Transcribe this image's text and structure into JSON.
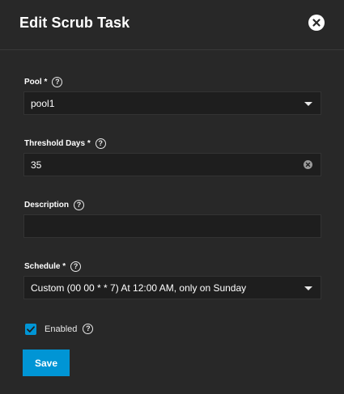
{
  "dialog": {
    "title": "Edit Scrub Task"
  },
  "form": {
    "pool": {
      "label": "Pool",
      "required_mark": "*",
      "value": "pool1"
    },
    "threshold_days": {
      "label": "Threshold Days",
      "required_mark": "*",
      "value": "35"
    },
    "description": {
      "label": "Description",
      "value": ""
    },
    "schedule": {
      "label": "Schedule",
      "required_mark": "*",
      "value": "Custom (00 00 * * 7) At 12:00 AM, only on Sunday"
    },
    "enabled": {
      "label": "Enabled",
      "checked": true
    }
  },
  "actions": {
    "save_label": "Save"
  },
  "colors": {
    "accent": "#0095d5",
    "background": "#282828",
    "field_bg": "#1e1e1e"
  },
  "icons": [
    "close-icon",
    "help-icon",
    "chevron-down-icon",
    "clear-icon",
    "checkmark-icon"
  ]
}
